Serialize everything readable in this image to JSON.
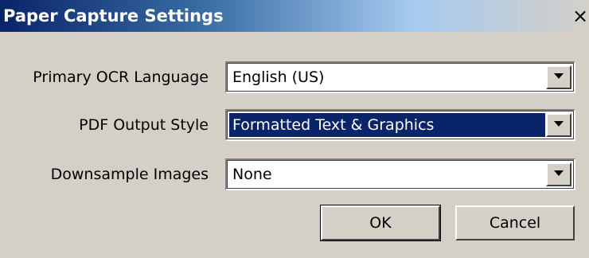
{
  "window": {
    "title": "Paper Capture Settings",
    "close_glyph": "✕"
  },
  "fields": [
    {
      "label": "Primary OCR Language",
      "value": "English (US)",
      "selected": false
    },
    {
      "label": "PDF Output Style",
      "value": "Formatted Text & Graphics",
      "selected": true
    },
    {
      "label": "Downsample Images",
      "value": "None",
      "selected": false
    }
  ],
  "buttons": {
    "ok_label": "OK",
    "cancel_label": "Cancel"
  },
  "icons": {
    "dropdown": "chevron-down-icon",
    "close": "close-icon"
  },
  "colors": {
    "titlebar_start": "#0a246a",
    "titlebar_end": "#d4d0c8",
    "selection": "#0a246a",
    "face": "#d4d0c8"
  }
}
